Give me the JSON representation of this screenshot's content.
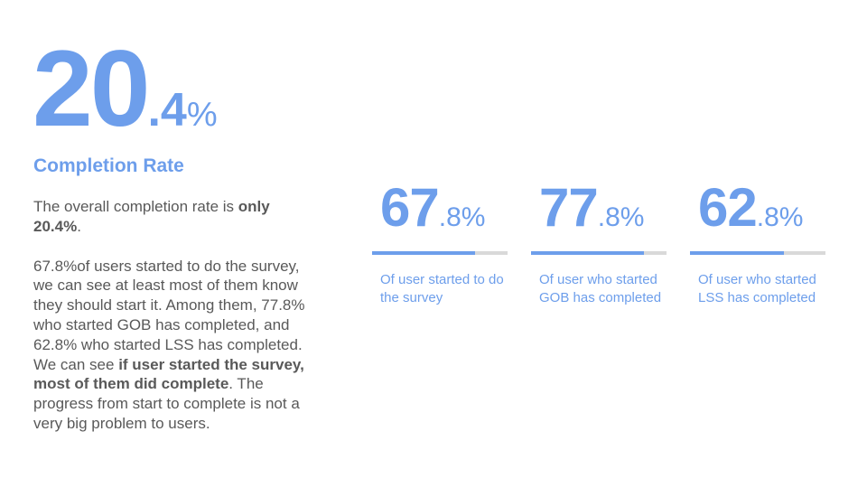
{
  "hero": {
    "integer": "20",
    "decimal": ".4",
    "percent": "%"
  },
  "subtitle": "Completion Rate",
  "body": {
    "p1_a": "The overall completion rate is ",
    "p1_b": "only 20.4%",
    "p1_c": ".",
    "p2_a": "67.8%of users started to do the survey, we can see at least most of them know they should start it. Among them, 77.8% who started GOB has completed, and 62.8% who started LSS has completed. We can see ",
    "p2_b": "if user started the survey, most of them did complete",
    "p2_c": ". The progress from start to complete is not a very big problem to users."
  },
  "stats": [
    {
      "integer": "67",
      "decimal": ".8",
      "percent": "%",
      "progress": 0.76,
      "caption": "Of user started to do the survey"
    },
    {
      "integer": "77",
      "decimal": ".8",
      "percent": "%",
      "progress": 0.83,
      "caption": "Of user who started GOB has completed"
    },
    {
      "integer": "62",
      "decimal": ".8",
      "percent": "%",
      "progress": 0.69,
      "caption": "Of user who started LSS has completed"
    }
  ],
  "colors": {
    "accent": "#6d9eeb",
    "text": "#595959",
    "track": "#d9d9d9"
  }
}
